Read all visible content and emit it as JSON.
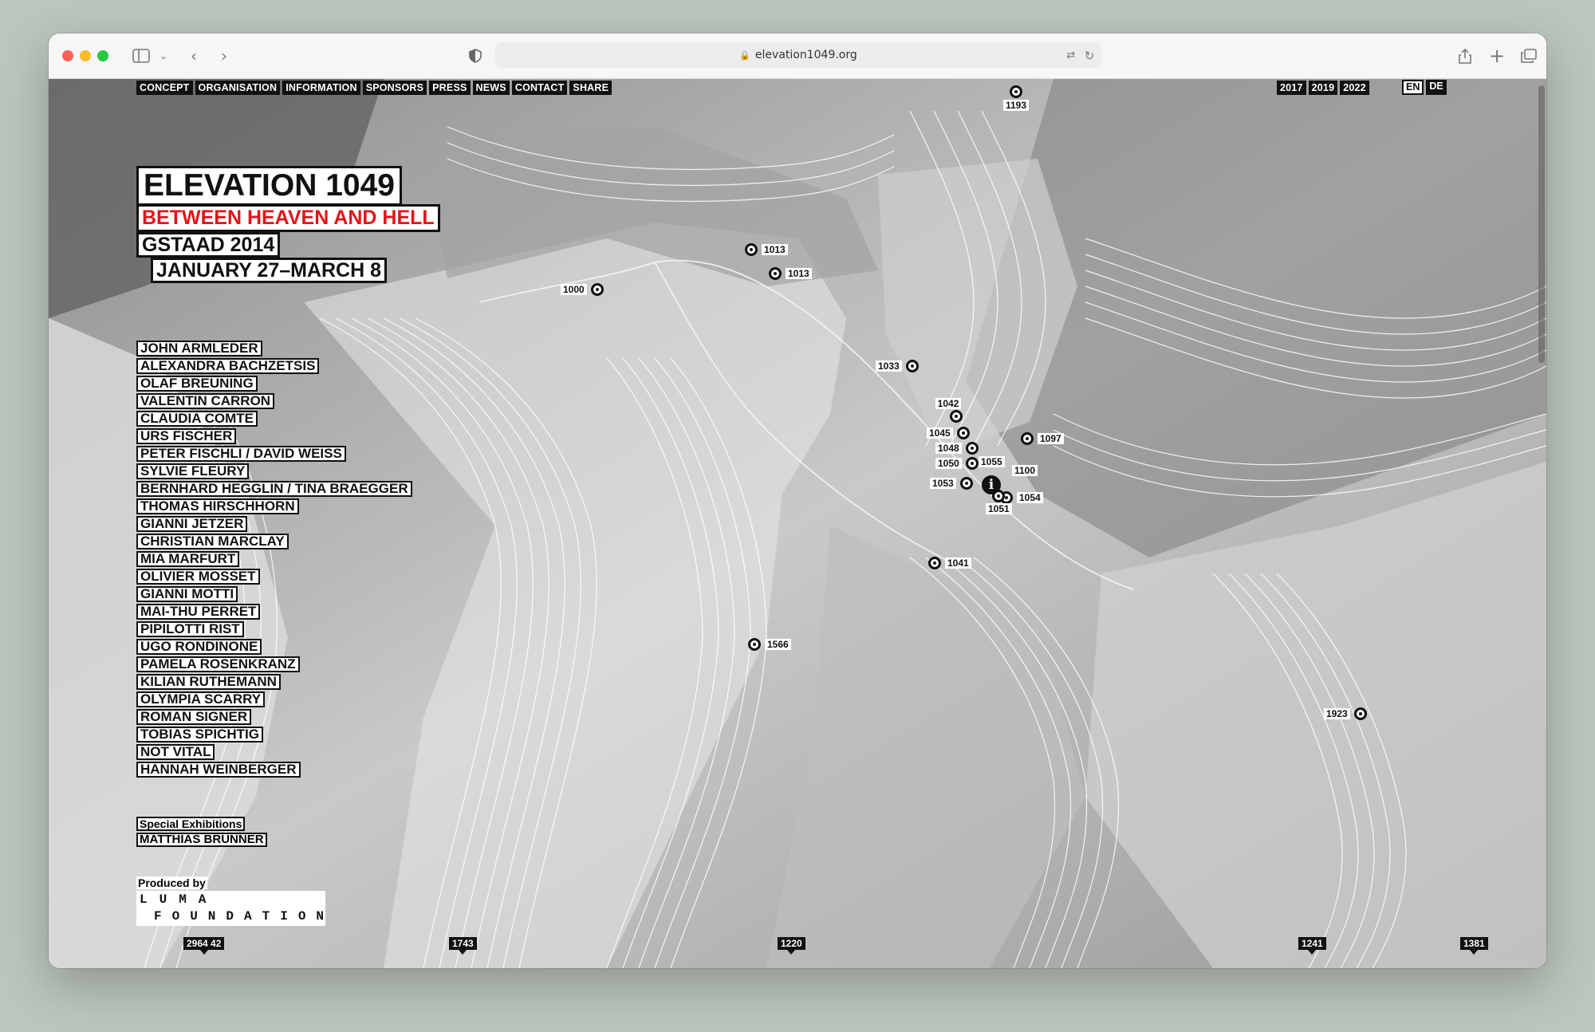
{
  "browser": {
    "url": "elevation1049.org"
  },
  "nav": {
    "items": [
      "CONCEPT",
      "ORGANISATION",
      "INFORMATION",
      "SPONSORS",
      "PRESS",
      "NEWS",
      "CONTACT",
      "SHARE"
    ],
    "years": [
      "2017",
      "2019",
      "2022"
    ],
    "lang": [
      "EN",
      "DE"
    ]
  },
  "title": {
    "main": "ELEVATION 1049",
    "subtitle": "BETWEEN HEAVEN AND HELL",
    "place": "GSTAAD 2014",
    "dates": "JANUARY 27–MARCH 8"
  },
  "artists": [
    "JOHN ARMLEDER",
    "ALEXANDRA BACHZETSIS",
    "OLAF BREUNING",
    "VALENTIN CARRON",
    "CLAUDIA COMTE",
    "URS FISCHER",
    "PETER FISCHLI / DAVID WEISS",
    "SYLVIE FLEURY",
    "BERNHARD HEGGLIN / TINA BRAEGGER",
    "THOMAS HIRSCHHORN",
    "GIANNI JETZER",
    "CHRISTIAN MARCLAY",
    "MIA MARFURT",
    "OLIVIER MOSSET",
    "GIANNI MOTTI",
    "MAI-THU PERRET",
    "PIPILOTTI RIST",
    "UGO RONDINONE",
    "PAMELA ROSENKRANZ",
    "KILIAN RÜTHEMANN",
    "OLYMPIA SCARRY",
    "ROMAN SIGNER",
    "TOBIAS SPICHTIG",
    "NOT VITAL",
    "HANNAH WEINBERGER"
  ],
  "special": {
    "heading": "Special Exhibitions",
    "name": "MATTHIAS BRUNNER"
  },
  "producer": {
    "heading": "Produced by",
    "logo_line1": "LUMA",
    "logo_line2": "FOUNDATION"
  },
  "markers": [
    "1193",
    "1013",
    "1013",
    "1000",
    "1033",
    "1042",
    "1045",
    "1048",
    "1050",
    "1055",
    "1100",
    "1097",
    "1053",
    "1054",
    "1051",
    "1041",
    "1566",
    "1923"
  ],
  "elevation_tags": [
    "2964 42",
    "1743",
    "1220",
    "1241",
    "1381"
  ],
  "info_icon_char": "i"
}
